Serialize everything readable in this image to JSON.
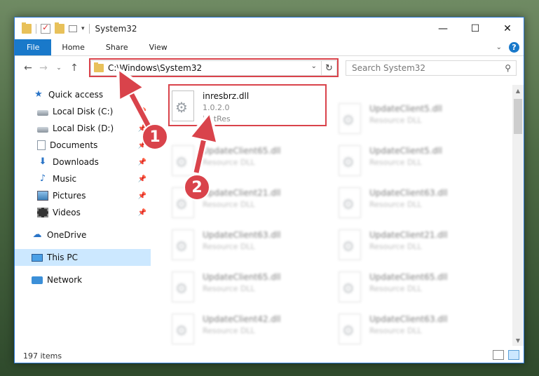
{
  "window": {
    "title": "System32",
    "controls": {
      "minimize": "—",
      "maximize": "☐",
      "close": "✕"
    }
  },
  "ribbon": {
    "tabs": [
      "File",
      "Home",
      "Share",
      "View"
    ],
    "help_symbol": "?"
  },
  "address_bar": {
    "path": "C:\\Windows\\System32",
    "refresh_symbol": "↻"
  },
  "search": {
    "placeholder": "Search System32"
  },
  "nav_pane": {
    "quick_access": "Quick access",
    "items": [
      {
        "label": "Local Disk (C:)",
        "pinned": true
      },
      {
        "label": "Local Disk (D:)",
        "pinned": true
      },
      {
        "label": "Documents",
        "pinned": true
      },
      {
        "label": "Downloads",
        "pinned": true
      },
      {
        "label": "Music",
        "pinned": true
      },
      {
        "label": "Pictures",
        "pinned": true
      },
      {
        "label": "Videos",
        "pinned": true
      }
    ],
    "onedrive": "OneDrive",
    "this_pc": "This PC",
    "network": "Network"
  },
  "files": {
    "highlighted": {
      "name": "inresbrz.dll",
      "version": "1.0.2.0",
      "description": "instRes"
    },
    "left_column": [
      {
        "name": "UpdateClient65.dll",
        "type": "Resource DLL"
      },
      {
        "name": "UpdateClient21.dll",
        "type": "Resource DLL"
      },
      {
        "name": "UpdateClient63.dll",
        "type": "Resource DLL"
      },
      {
        "name": "UpdateClient65.dll",
        "type": "Resource DLL"
      },
      {
        "name": "UpdateClient42.dll",
        "type": "Resource DLL"
      }
    ],
    "right_column": [
      {
        "name": "UpdateClient5.dll",
        "type": "Resource DLL"
      },
      {
        "name": "UpdateClient5.dll",
        "type": "Resource DLL"
      },
      {
        "name": "UpdateClient63.dll",
        "type": "Resource DLL"
      },
      {
        "name": "UpdateClient21.dll",
        "type": "Resource DLL"
      },
      {
        "name": "UpdateClient65.dll",
        "type": "Resource DLL"
      },
      {
        "name": "UpdateClient63.dll",
        "type": "Resource DLL"
      }
    ]
  },
  "status": {
    "item_count": "197 items"
  },
  "annotations": {
    "marker1": "1",
    "marker2": "2",
    "color": "#d9434b"
  }
}
